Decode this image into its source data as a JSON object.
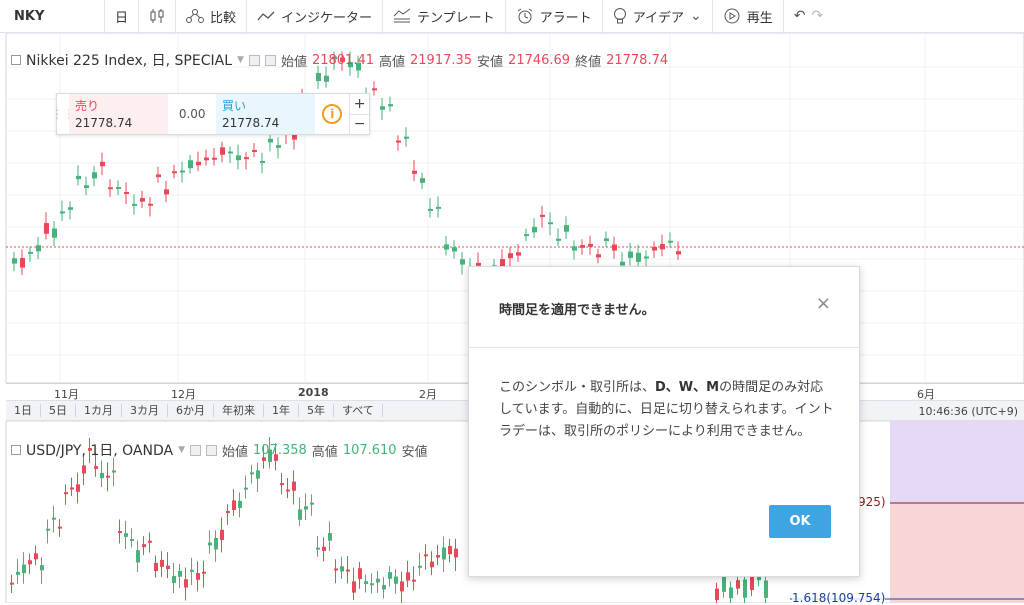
{
  "toolbar": {
    "symbol": "NKY",
    "interval": "日",
    "compare_label": "比較",
    "indicators_label": "インジケーター",
    "templates_label": "テンプレート",
    "alert_label": "アラート",
    "ideas_label": "アイデア",
    "replay_label": "再生"
  },
  "chart1": {
    "title": "Nikkei 225 Index, 日, SPECIAL",
    "open_label": "始値",
    "open_value": "21801.41",
    "high_label": "高値",
    "high_value": "21917.35",
    "low_label": "安値",
    "low_value": "21746.69",
    "close_label": "終値",
    "close_value": "21778.74",
    "trade": {
      "sell_label": "売り",
      "sell_value": "21778.74",
      "spread": "0.00",
      "buy_label": "買い",
      "buy_value": "21778.74",
      "plus": "+",
      "minus": "−",
      "info_icon": "i"
    }
  },
  "timeaxis": {
    "t1": "11月",
    "t2": "12月",
    "t3": "2018",
    "t4": "2月",
    "t5": "6月"
  },
  "ranges": [
    "1日",
    "5日",
    "1カ月",
    "3カ月",
    "6か月",
    "年初来",
    "1年",
    "5年",
    "すべて"
  ],
  "clock": "10:46:36 (UTC+9)",
  "chart2": {
    "title": "USD/JPY, 1日, OANDA",
    "open_label": "始値",
    "open_value": "107.358",
    "high_label": "高値",
    "high_value": "107.610",
    "low_label": "安値",
    "level1": "925)",
    "level2": "1.618(109.754)"
  },
  "dialog": {
    "title": "時間足を適用できません。",
    "close": "×",
    "body_1": "このシンボル・取引所は、",
    "body_bold": "D、W、M",
    "body_2": "の時間足のみ対応しています。自動的に、日足に切り替えられます。イントラデーは、取引所のポリシーにより利用できません。",
    "ok": "OK"
  },
  "colors": {
    "up": "#48b27a",
    "down": "#e8485a",
    "accent": "#3ca5e2"
  }
}
